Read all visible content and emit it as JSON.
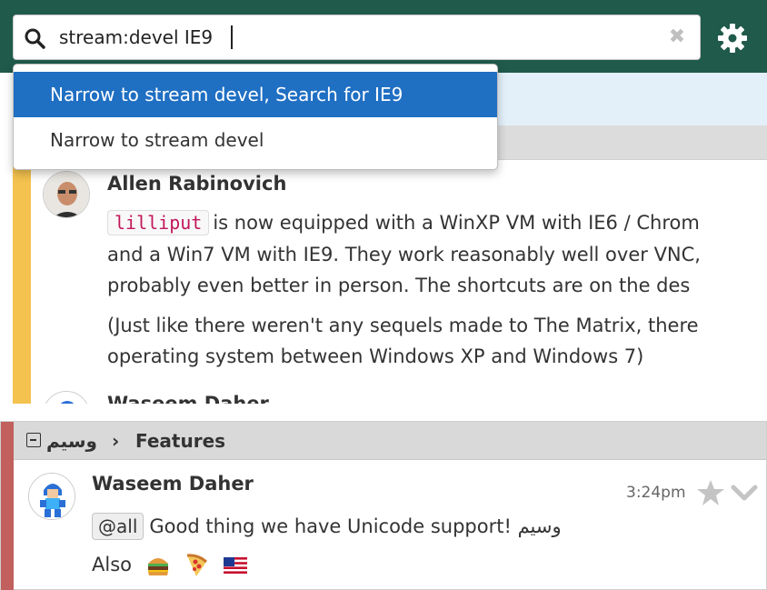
{
  "search": {
    "query": "stream:devel IE9",
    "suggestions": [
      {
        "label": "Narrow to stream devel, Search for IE9",
        "active": true
      },
      {
        "label": "Narrow to stream devel",
        "active": false
      }
    ]
  },
  "top_message": {
    "sender": "Allen Rabinovich",
    "code": "lilliput",
    "line1_rest": "is now equipped with a WinXP VM with IE6 / Chrom",
    "line2": "and a Win7 VM with IE9. They work reasonably well over VNC,",
    "line3": "probably even better in person. The shortcuts are on the des",
    "line4": "(Just like there weren't any sequels made to The Matrix, there",
    "line5": "operating system between Windows XP and Windows 7)",
    "next_sender": "Waseem Daher"
  },
  "bottom_message": {
    "stream": "وسيم",
    "separator": "›",
    "topic": "Features",
    "sender": "Waseem Daher",
    "time": "3:24pm",
    "mention": "@all",
    "text": "Good thing we have Unicode support! وسيم",
    "also": "Also",
    "emojis": [
      "hamburger-emoji",
      "pizza-emoji",
      "us-flag-emoji"
    ]
  },
  "icons": {
    "search": "search-icon",
    "clear": "close-icon",
    "settings": "gear-icon",
    "star": "star-icon",
    "menu": "chevron-down-icon"
  },
  "colors": {
    "header": "#1f5a4b",
    "active_suggestion": "#1f6fc3",
    "stream_devel": "#f4c24f",
    "stream_waseem": "#c1605c",
    "code_text": "#c2185b"
  }
}
